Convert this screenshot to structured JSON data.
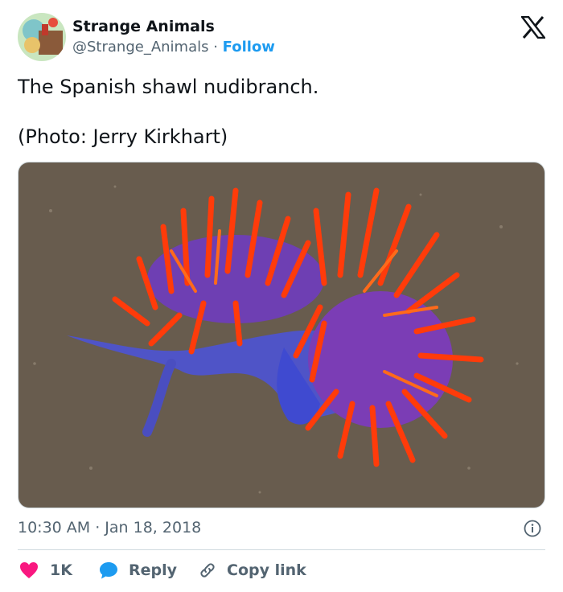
{
  "tweet": {
    "author_name": "Strange Animals",
    "handle": "@Strange_Animals",
    "separator": " · ",
    "follow_label": "Follow",
    "text_line1": "The Spanish shawl nudibranch.",
    "text_line2": "(Photo: Jerry Kirkhart)",
    "time": "10:30 AM · Jan 18, 2018",
    "like_count": "1K",
    "reply_label": "Reply",
    "copy_label": "Copy link"
  },
  "colors": {
    "accent": "#1d9bf0",
    "like": "#f91880",
    "muted": "#536471"
  },
  "icons": [
    "x-logo-icon",
    "info-icon",
    "heart-icon",
    "reply-bubble-icon",
    "link-icon"
  ]
}
